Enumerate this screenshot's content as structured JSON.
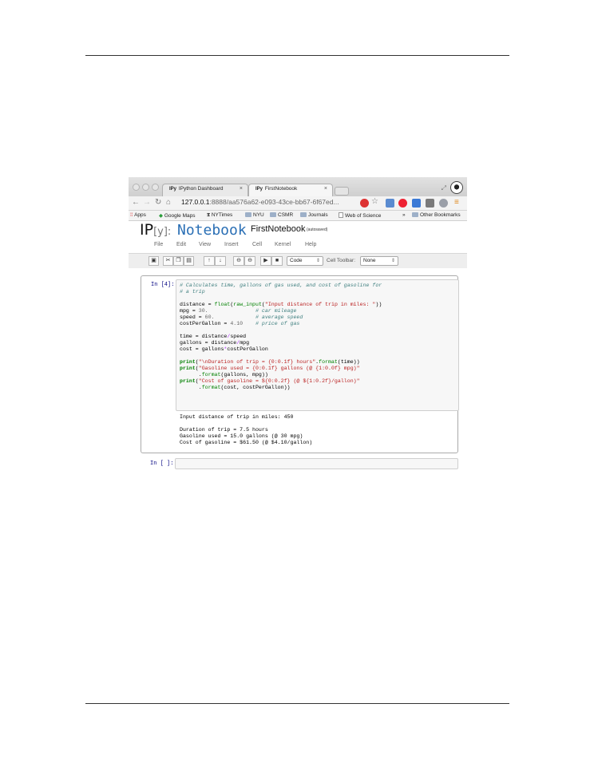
{
  "browser": {
    "tabs": [
      {
        "icon_text": "IPy",
        "label": "IPython Dashboard"
      },
      {
        "icon_text": "IPy",
        "label": "FirstNotebook"
      }
    ],
    "url_host": "127.0.0.1",
    "url_rest": ":8888/aa576a62-e093-43ce-bb67-6f67ed...",
    "bookmarks": [
      "Apps",
      "Google Maps",
      "NYTimes",
      "NYU",
      "CSMR",
      "Journals",
      "Web of Science"
    ],
    "overflow": "»",
    "other_bookmarks": "Other Bookmarks"
  },
  "notebook": {
    "logo_ip": "IP",
    "logo_y": "[y]:",
    "logo_word": "Notebook",
    "name": "FirstNotebook",
    "autosave": "(autosaved)",
    "menu": [
      "File",
      "Edit",
      "View",
      "Insert",
      "Cell",
      "Kernel",
      "Help"
    ],
    "toolbar": {
      "cell_type": "Code",
      "cell_toolbar_label": "Cell Toolbar:",
      "cell_toolbar_value": "None"
    }
  },
  "cells": [
    {
      "prompt": "In [4]:",
      "code": [
        "# Calculates time, gallons of gas used, and cost of gasoline for",
        "# a trip",
        "",
        "distance = float(raw_input(\"Input distance of trip in miles: \"))",
        "mpg = 30.               # car mileage",
        "speed = 60.             # average speed",
        "costPerGallon = 4.10    # price of gas",
        "",
        "time = distance/speed",
        "gallons = distance/mpg",
        "cost = gallons*costPerGallon",
        "",
        "print(\"\\nDuration of trip = {0:0.1f} hours\".format(time))",
        "print(\"Gasoline used = {0:0.1f} gallons (@ {1:0.0f} mpg)\"",
        "      .format(gallons, mpg))",
        "print(\"Cost of gasoline = ${0:0.2f} (@ ${1:0.2f}/gallon)\"",
        "      .format(cost, costPerGallon))"
      ],
      "output": [
        "Input distance of trip in miles: 450",
        "",
        "Duration of trip = 7.5 hours",
        "Gasoline used = 15.0 gallons (@ 30 mpg)",
        "Cost of gasoline = $61.50 (@ $4.10/gallon)"
      ]
    },
    {
      "prompt": "In [ ]:",
      "code": [
        ""
      ]
    }
  ]
}
